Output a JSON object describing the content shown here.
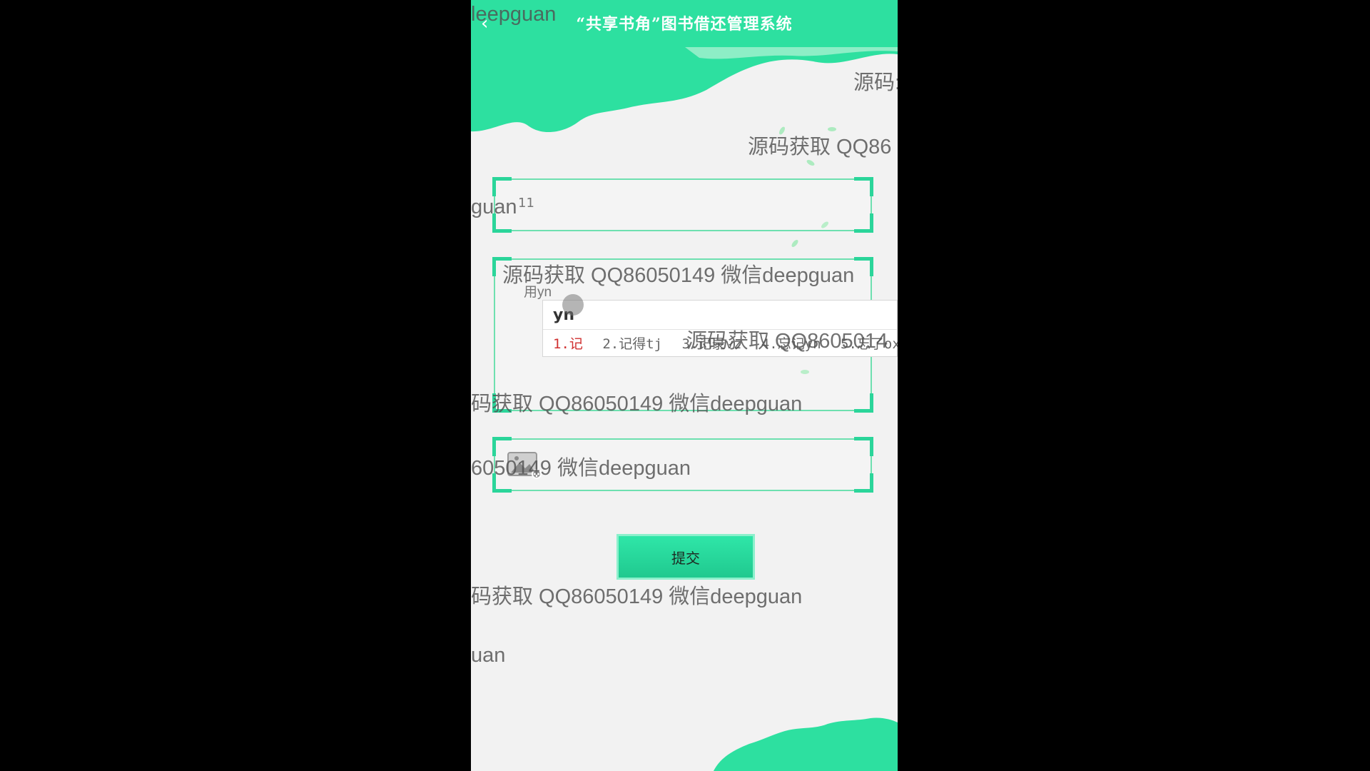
{
  "header": {
    "title": "“共享书角”图书借还管理系统",
    "back_icon": "chevron-left-icon",
    "color": "#2de0a0"
  },
  "form": {
    "field1_value": "",
    "field1_superscript": "11",
    "textarea_label": "用yn",
    "submit_label": "提交"
  },
  "ime": {
    "input": "yn",
    "candidates": [
      "1.记",
      "2.记得tj",
      "3.记录vz",
      "4.忘记yn",
      "5.忘了ox"
    ]
  },
  "watermark": {
    "full": "源码获取 QQ86050149 微信deepguan",
    "frag_top_left": "leepguan",
    "frag_top_right": "源码:",
    "frag_qq": "源码获取 QQ86",
    "frag_field1": "guan",
    "frag_ime": "源码获取 QQ8605014",
    "frag_mid": "码获取 QQ86050149 微信deepguan",
    "frag_image": "6050149 微信deepguan",
    "frag_below_submit": "码获取 QQ86050149 微信deepguan",
    "frag_bottom": "uan"
  }
}
